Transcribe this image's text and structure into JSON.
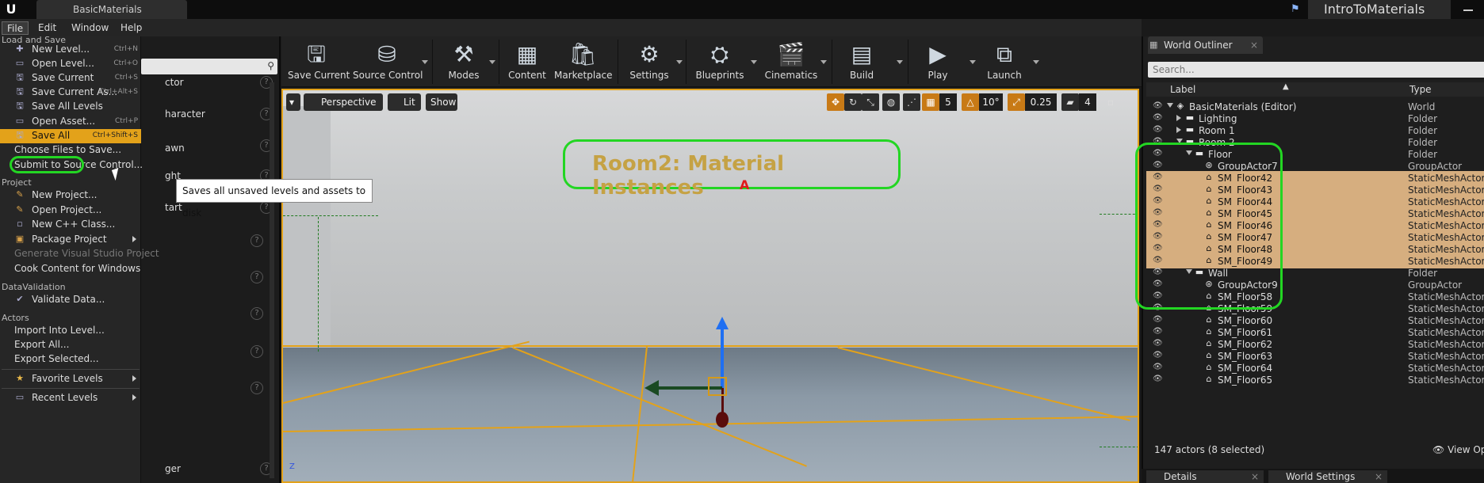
{
  "title_bar": {
    "doc_tab": "BasicMaterials",
    "project": "IntroToMaterials"
  },
  "menubar": {
    "items": [
      "File",
      "Edit",
      "Window",
      "Help"
    ]
  },
  "file_menu": {
    "sections": {
      "load_save": "Load and Save",
      "project": "Project",
      "data_validation": "DataValidation",
      "actors": "Actors"
    },
    "items": [
      {
        "label": "New Level...",
        "shortcut": "Ctrl+N"
      },
      {
        "label": "Open Level...",
        "shortcut": "Ctrl+O"
      },
      {
        "label": "Save Current",
        "shortcut": "Ctrl+S"
      },
      {
        "label": "Save Current As...",
        "shortcut": "Ctrl+Alt+S"
      },
      {
        "label": "Save All Levels",
        "shortcut": ""
      },
      {
        "label": "Open Asset...",
        "shortcut": "Ctrl+P"
      },
      {
        "label": "Save All",
        "shortcut": "Ctrl+Shift+S"
      },
      {
        "label": "Choose Files to Save...",
        "shortcut": ""
      },
      {
        "label": "Submit to Source Control...",
        "shortcut": ""
      },
      {
        "label": "New Project...",
        "shortcut": ""
      },
      {
        "label": "Open Project...",
        "shortcut": ""
      },
      {
        "label": "New C++ Class...",
        "shortcut": ""
      },
      {
        "label": "Package Project",
        "shortcut": ""
      },
      {
        "label": "Generate Visual Studio Project",
        "shortcut": ""
      },
      {
        "label": "Cook Content for Windows",
        "shortcut": ""
      },
      {
        "label": "Validate Data...",
        "shortcut": ""
      },
      {
        "label": "Import Into Level...",
        "shortcut": ""
      },
      {
        "label": "Export All...",
        "shortcut": ""
      },
      {
        "label": "Export Selected...",
        "shortcut": ""
      },
      {
        "label": "Favorite Levels",
        "shortcut": ""
      },
      {
        "label": "Recent Levels",
        "shortcut": ""
      }
    ],
    "tooltip": "Saves all unsaved levels and assets to disk"
  },
  "modes_panel": {
    "items": [
      "ctor",
      "haracter",
      "awn",
      "ght",
      "tart",
      "ger"
    ]
  },
  "toolbar": {
    "buttons": [
      "Save Current",
      "Source Control",
      "Modes",
      "Content",
      "Marketplace",
      "Settings",
      "Blueprints",
      "Cinematics",
      "Build",
      "Play",
      "Launch"
    ]
  },
  "viewport": {
    "perspective": "Perspective",
    "lit": "Lit",
    "show": "Show",
    "grid_snap": "5",
    "rot_snap": "10°",
    "scale_snap": "0.25",
    "cam_speed": "4",
    "room_label": "Room2: Material Instances",
    "marker": "A",
    "axis": "Z"
  },
  "outliner": {
    "tab": "World Outliner",
    "search_placeholder": "Search...",
    "col_label": "Label",
    "col_type": "Type",
    "rows": [
      {
        "name": "BasicMaterials (Editor)",
        "type": "World"
      },
      {
        "name": "Lighting",
        "type": "Folder"
      },
      {
        "name": "Room 1",
        "type": "Folder"
      },
      {
        "name": "Room 2",
        "type": "Folder"
      },
      {
        "name": "Floor",
        "type": "Folder"
      },
      {
        "name": "GroupActor7",
        "type": "GroupActor"
      },
      {
        "name": "SM_Floor42",
        "type": "StaticMeshActor"
      },
      {
        "name": "SM_Floor43",
        "type": "StaticMeshActor"
      },
      {
        "name": "SM_Floor44",
        "type": "StaticMeshActor"
      },
      {
        "name": "SM_Floor45",
        "type": "StaticMeshActor"
      },
      {
        "name": "SM_Floor46",
        "type": "StaticMeshActor"
      },
      {
        "name": "SM_Floor47",
        "type": "StaticMeshActor"
      },
      {
        "name": "SM_Floor48",
        "type": "StaticMeshActor"
      },
      {
        "name": "SM_Floor49",
        "type": "StaticMeshActor"
      },
      {
        "name": "Wall",
        "type": "Folder"
      },
      {
        "name": "GroupActor9",
        "type": "GroupActor"
      },
      {
        "name": "SM_Floor58",
        "type": "StaticMeshActor"
      },
      {
        "name": "SM_Floor59",
        "type": "StaticMeshActor"
      },
      {
        "name": "SM_Floor60",
        "type": "StaticMeshActor"
      },
      {
        "name": "SM_Floor61",
        "type": "StaticMeshActor"
      },
      {
        "name": "SM_Floor62",
        "type": "StaticMeshActor"
      },
      {
        "name": "SM_Floor63",
        "type": "StaticMeshActor"
      },
      {
        "name": "SM_Floor64",
        "type": "StaticMeshActor"
      },
      {
        "name": "SM_Floor65",
        "type": "StaticMeshActor"
      }
    ],
    "status": "147 actors (8 selected)",
    "view_options": "View Opt"
  },
  "bottom_tabs": [
    "Details",
    "World Settings"
  ],
  "colors": {
    "accent": "#e3a21a",
    "selection": "#d6ae7f",
    "annotation": "#23d623"
  }
}
